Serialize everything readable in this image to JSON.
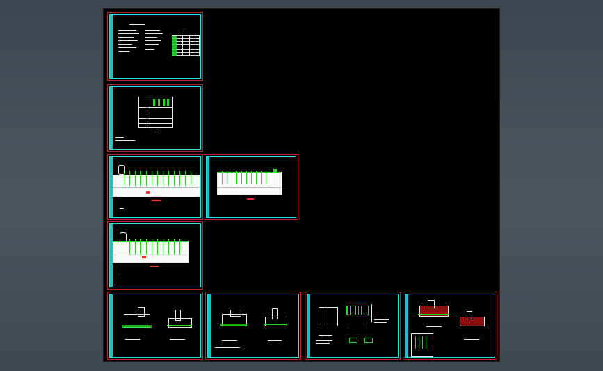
{
  "app": {
    "model_space": "model-space-canvas"
  },
  "colors": {
    "background": "#000000",
    "sheet_frame": "#c0202a",
    "sheet_border": "#25e2e8",
    "line_white": "#e8e8e8",
    "line_green": "#22dd22",
    "line_red": "#ff3030"
  },
  "sheets": [
    {
      "id": "sheet-1",
      "content": "notes-and-table"
    },
    {
      "id": "sheet-2",
      "content": "system-table"
    },
    {
      "id": "sheet-3",
      "content": "single-line-diagram-a"
    },
    {
      "id": "sheet-4",
      "content": "single-line-diagram-b"
    },
    {
      "id": "sheet-5",
      "content": "single-line-diagram-c"
    },
    {
      "id": "sheet-6",
      "content": "equipment-elevation-a"
    },
    {
      "id": "sheet-7",
      "content": "equipment-elevation-b"
    },
    {
      "id": "sheet-8",
      "content": "building-elevation"
    },
    {
      "id": "sheet-9",
      "content": "equipment-plan"
    }
  ]
}
